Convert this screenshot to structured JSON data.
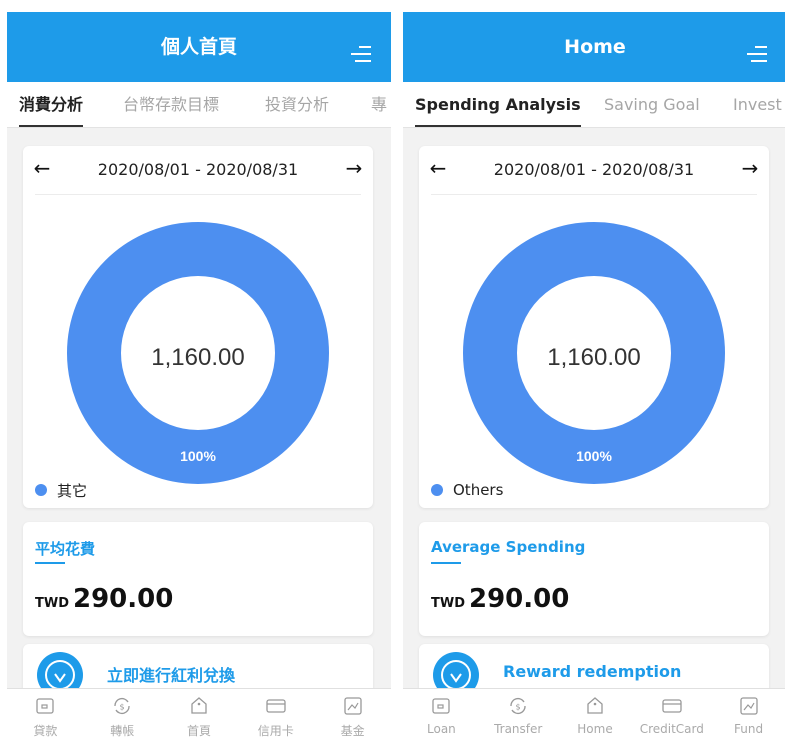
{
  "screens": [
    {
      "title": "個人首頁",
      "tabs": [
        {
          "label": "消費分析",
          "active": true
        },
        {
          "label": "台幣存款目標",
          "active": false
        },
        {
          "label": "投資分析",
          "active": false
        },
        {
          "label": "專",
          "active": false
        }
      ],
      "date_range": "2020/08/01 - 2020/08/31",
      "prev_arrow": "←",
      "next_arrow": "→",
      "donut": {
        "total": "1,160.00",
        "percent_label": "100%",
        "share": 1.0,
        "color": "#4d8ff0"
      },
      "legend": [
        {
          "label": "其它",
          "color": "#4d8ff0"
        }
      ],
      "average_spending": {
        "title": "平均花費",
        "currency": "TWD",
        "value": "290.00"
      },
      "reward": {
        "label": "立即進行紅利兌換",
        "icon": "lightbulb-icon"
      },
      "bottom_nav": [
        {
          "label": "貸款",
          "icon": "wallet-icon"
        },
        {
          "label": "轉帳",
          "icon": "transfer-icon"
        },
        {
          "label": "首頁",
          "icon": "home-icon"
        },
        {
          "label": "信用卡",
          "icon": "credit-card-icon"
        },
        {
          "label": "基金",
          "icon": "fund-chart-icon"
        }
      ]
    },
    {
      "title": "Home",
      "tabs": [
        {
          "label": "Spending Analysis",
          "active": true
        },
        {
          "label": "Saving Goal",
          "active": false
        },
        {
          "label": "Invest",
          "active": false
        }
      ],
      "date_range": "2020/08/01 - 2020/08/31",
      "prev_arrow": "←",
      "next_arrow": "→",
      "donut": {
        "total": "1,160.00",
        "percent_label": "100%",
        "share": 1.0,
        "color": "#4d8ff0"
      },
      "legend": [
        {
          "label": "Others",
          "color": "#4d8ff0"
        }
      ],
      "average_spending": {
        "title": "Average Spending",
        "currency": "TWD",
        "value": "290.00"
      },
      "reward": {
        "label": "Reward redemption",
        "icon": "lightbulb-icon"
      },
      "bottom_nav": [
        {
          "label": "Loan",
          "icon": "wallet-icon"
        },
        {
          "label": "Transfer",
          "icon": "transfer-icon"
        },
        {
          "label": "Home",
          "icon": "home-icon"
        },
        {
          "label": "CreditCard",
          "icon": "credit-card-icon"
        },
        {
          "label": "Fund",
          "icon": "fund-chart-icon"
        }
      ]
    }
  ],
  "colors": {
    "primary": "#1e9be9",
    "donut": "#4d8ff0",
    "background": "#f2f2f2"
  }
}
